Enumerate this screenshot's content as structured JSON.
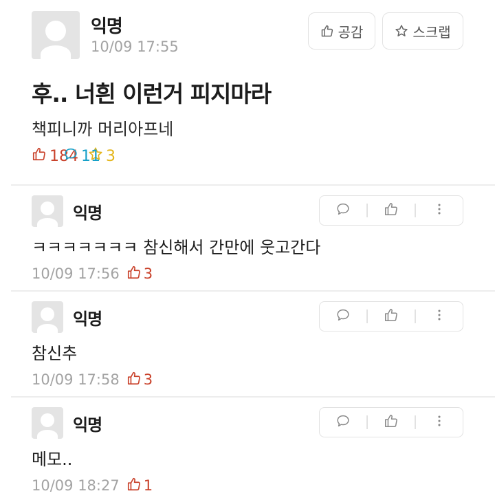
{
  "post": {
    "author": "익명",
    "time": "10/09 17:55",
    "title": "후.. 너흰 이런거 피지마라",
    "body": "책피니까 머리아프네",
    "stats": {
      "likes": "184",
      "comments": "11",
      "scraps": "3"
    },
    "buttons": {
      "like_label": "공감",
      "scrap_label": "스크랩"
    }
  },
  "comments": [
    {
      "author": "익명",
      "text": "ㅋㅋㅋㅋㅋㅋㅋ 참신해서 간만에 웃고간다",
      "time": "10/09 17:56",
      "likes": "3"
    },
    {
      "author": "익명",
      "text": "참신추",
      "time": "10/09 17:58",
      "likes": "3"
    },
    {
      "author": "익명",
      "text": "메모..",
      "time": "10/09 18:27",
      "likes": "1"
    }
  ],
  "colors": {
    "like": "#c9412a",
    "comment": "#14a0c8",
    "scrap": "#e4b51a",
    "muted": "#a3a3a3"
  },
  "icons": [
    "thumbs-up-icon",
    "speech-bubble-icon",
    "star-icon",
    "more-vertical-icon"
  ]
}
